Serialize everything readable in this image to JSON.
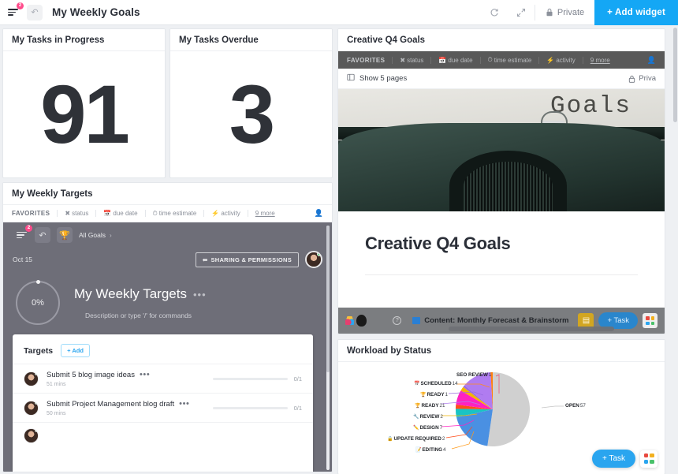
{
  "topbar": {
    "menu_badge": "2",
    "undo_icon": "undo-icon",
    "title": "My Weekly Goals",
    "refresh_icon": "refresh-icon",
    "expand_icon": "expand-icon",
    "lock_icon": "lock-icon",
    "private_label": "Private",
    "add_widget_label": "+ Add widget"
  },
  "cards": {
    "tasks_in_progress": {
      "title": "My Tasks in Progress",
      "value": "91"
    },
    "tasks_overdue": {
      "title": "My Tasks Overdue",
      "value": "3"
    }
  },
  "weekly_targets": {
    "title": "My Weekly Targets",
    "tabs": [
      {
        "label": "FAVORITES",
        "icon": ""
      },
      {
        "label": "status",
        "icon": "✖"
      },
      {
        "label": "due date",
        "icon": "📅"
      },
      {
        "label": "time estimate",
        "icon": "⏱"
      },
      {
        "label": "activity",
        "icon": "⚡"
      },
      {
        "label": "9 more",
        "icon": ""
      }
    ],
    "person_icon": "person-icon",
    "embed": {
      "menu_badge": "2",
      "undo_icon": "undo-icon",
      "trophy_icon": "trophy-icon",
      "breadcrumb": "All Goals",
      "breadcrumb_chevron": "›",
      "date": "Oct 15",
      "share_label": "SHARING & PERMISSIONS",
      "share_icon": "share-icon",
      "progress_pct": "0%",
      "goal_title": "My Weekly Targets",
      "goal_menu_dots": "•••",
      "description_placeholder": "Description or type '/' for commands",
      "targets_label": "Targets",
      "add_label": "+ Add",
      "targets": [
        {
          "name": "Submit 5 blog image ideas",
          "dots": "•••",
          "time": "51 mins",
          "count": "0/1"
        },
        {
          "name": "Submit Project Management blog draft",
          "dots": "•••",
          "time": "50 mins",
          "count": "0/1"
        }
      ]
    }
  },
  "creative": {
    "title": "Creative Q4 Goals",
    "tabs": [
      {
        "label": "FAVORITES",
        "icon": ""
      },
      {
        "label": "status",
        "icon": "✖"
      },
      {
        "label": "due date",
        "icon": "📅"
      },
      {
        "label": "time estimate",
        "icon": "⏱"
      },
      {
        "label": "activity",
        "icon": "⚡"
      },
      {
        "label": "9 more",
        "icon": ""
      }
    ],
    "pages_icon": "pages-icon",
    "pages_label": "Show 5 pages",
    "lock_icon": "lock-icon",
    "private_label": "Priva",
    "hero_paper_word": "Goals",
    "doc_title": "Creative Q4 Goals",
    "overlay": {
      "help_icon": "?",
      "breadcrumb": "Content: Monthly Forecast & Brainstorm",
      "list_icon": "list-icon",
      "task_label": "+ Task",
      "apps_icon": "apps-icon"
    }
  },
  "workload": {
    "title": "Workload by Status",
    "fab_task_label": "+ Task",
    "fab_apps_icon": "apps-icon"
  },
  "chart_data": {
    "type": "pie",
    "title": "Workload by Status",
    "legend_position": "callout-labels",
    "categories": [
      "OPEN",
      "READY",
      "EDITING",
      "UPDATE REQUIRED",
      "DESIGN",
      "REVIEW",
      "READY",
      "SCHEDULED",
      "SEO REVIEW"
    ],
    "labels": [
      {
        "emoji": "",
        "name": "SEO REVIEW",
        "value": 1,
        "color": "#ef2f5b"
      },
      {
        "emoji": "📅",
        "name": "SCHEDULED",
        "value": 14,
        "color": "#ff7f0e"
      },
      {
        "emoji": "🏆",
        "name": "READY",
        "value": 1,
        "color": "#9b6ce0"
      },
      {
        "emoji": "🏆",
        "name": "READY",
        "value": 21,
        "color": "#b07cf0"
      },
      {
        "emoji": "🔧",
        "name": "REVIEW",
        "value": 2,
        "color": "#f4b400"
      },
      {
        "emoji": "✏️",
        "name": "DESIGN",
        "value": 7,
        "color": "#ff22c0"
      },
      {
        "emoji": "🔒",
        "name": "UPDATE REQUIRED",
        "value": 2,
        "color": "#ff4d1a"
      },
      {
        "emoji": "📝",
        "name": "EDITING",
        "value": 4,
        "color": "#19c4c4"
      },
      {
        "emoji": "",
        "name": "OPEN",
        "value": 57,
        "color": "#d0d0d0"
      }
    ],
    "values": [
      57,
      21,
      4,
      2,
      7,
      2,
      1,
      14,
      1
    ],
    "colors": [
      "#d0d0d0",
      "#4a90e2",
      "#19c4c4",
      "#ff4d1a",
      "#ff22c0",
      "#f4b400",
      "#9b6ce0",
      "#b07cf0",
      "#ff7f0e"
    ],
    "blue_slice_label": "READY 21"
  }
}
